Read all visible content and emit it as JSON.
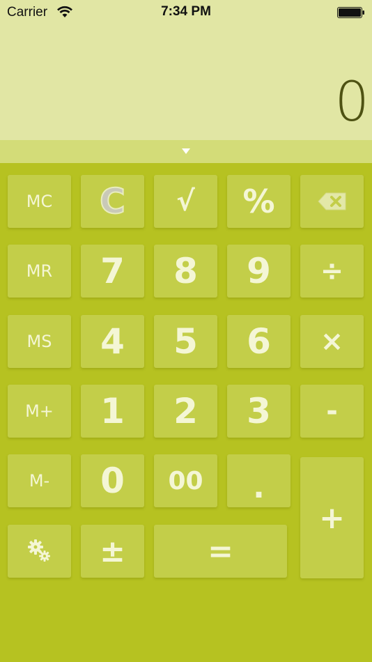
{
  "status_bar": {
    "carrier": "Carrier",
    "time": "7:34 PM",
    "wifi_icon": "wifi-icon",
    "battery_icon": "battery-icon"
  },
  "display": {
    "value": "0"
  },
  "collapse": {
    "icon": "chevron-down-icon"
  },
  "keys": {
    "mc": "MC",
    "clear": "C",
    "sqrt": "√",
    "percent": "%",
    "backspace_icon": "backspace-icon",
    "mr": "MR",
    "seven": "7",
    "eight": "8",
    "nine": "9",
    "divide": "÷",
    "ms": "MS",
    "four": "4",
    "five": "5",
    "six": "6",
    "multiply": "×",
    "mplus": "M+",
    "one": "1",
    "two": "2",
    "three": "3",
    "minus": "-",
    "mminus": "M-",
    "zero": "0",
    "double_zero": "00",
    "decimal": ".",
    "plus": "+",
    "settings_icon": "gear-icon",
    "plus_minus": "±",
    "equals": "="
  },
  "colors": {
    "display_bg": "#e1e6a4",
    "collapse_bg": "#d3dc78",
    "keypad_bg": "#b6c221",
    "key_bg": "#c3ce49",
    "key_text": "#f4f6d5",
    "display_text": "#4e5213"
  }
}
